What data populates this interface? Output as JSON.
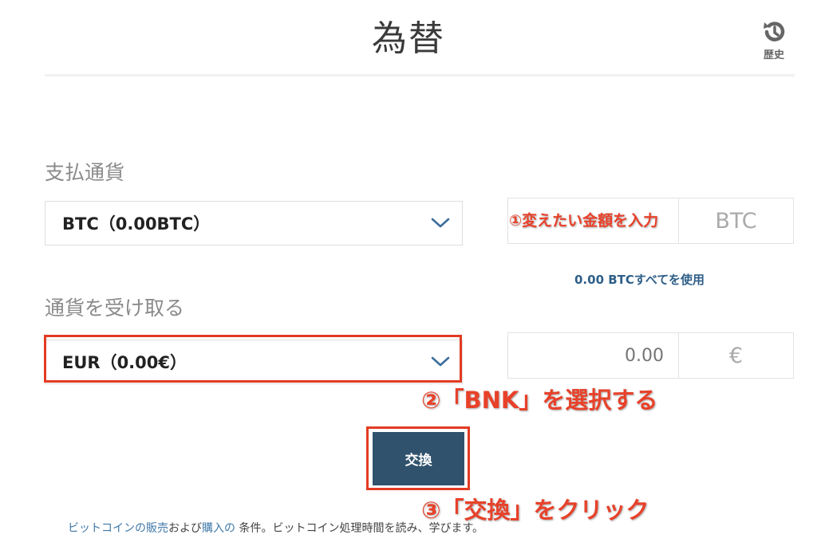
{
  "header": {
    "title": "為替",
    "history_label": "歴史",
    "history_icon": "history-icon"
  },
  "pay": {
    "section_label": "支払通貨",
    "currency_value": "BTC（0.00BTC）",
    "amount_value": "",
    "unit": "BTC",
    "use_all_link": "0.00 BTCすべてを使用"
  },
  "receive": {
    "section_label": "通貨を受け取る",
    "currency_value": "EUR（0.00€）",
    "amount_placeholder": "0.00",
    "unit": "€"
  },
  "exchange_button": "交換",
  "annotations": {
    "step1": "①変えたい金額を入力",
    "step2": "②「BNK」を選択する",
    "step3": "③「交換」をクリック"
  },
  "footer": {
    "link_sell": "ビットコインの販売",
    "text_and": "および",
    "link_buy": "購入の",
    "text_rest": " 条件。ビットコイン処理時間を読み、学びます。"
  },
  "colors": {
    "accent_dark": "#30526d",
    "link_blue": "#2f5f89",
    "annotation_red": "#e8412a"
  }
}
